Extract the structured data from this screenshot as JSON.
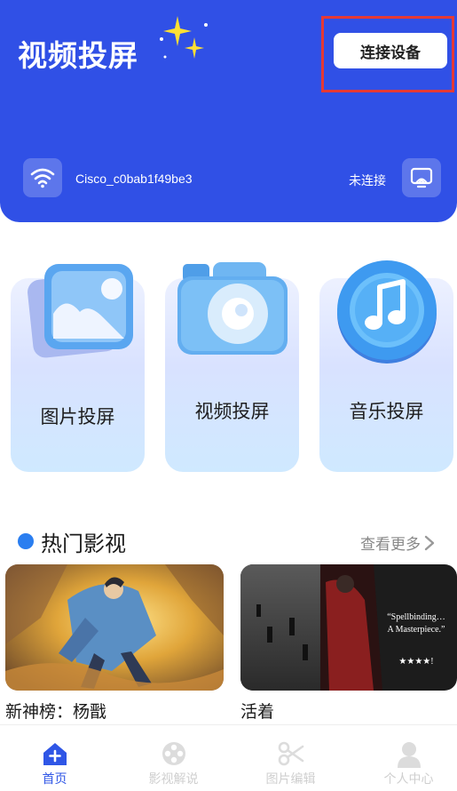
{
  "header": {
    "title": "视频投屏",
    "connect_button": "连接设备",
    "wifi_name": "Cisco_c0bab1f49be3",
    "connection_status": "未连接",
    "wifi_icon": "wifi-icon",
    "cast_icon": "screen-cast-icon"
  },
  "features": [
    {
      "label": "图片投屏",
      "icon": "image-icon"
    },
    {
      "label": "视频投屏",
      "icon": "camera-icon"
    },
    {
      "label": "音乐投屏",
      "icon": "music-note-icon"
    }
  ],
  "section": {
    "title": "热门影视",
    "see_more": "查看更多"
  },
  "movies": [
    {
      "title": "新神榜：杨戬"
    },
    {
      "title": "活着",
      "poster_quote": "“Spellbinding… A Masterpiece.”",
      "poster_stars": "★★★★!"
    }
  ],
  "bottom_nav": [
    {
      "label": "首页",
      "icon": "home-icon",
      "active": true
    },
    {
      "label": "影视解说",
      "icon": "film-reel-icon",
      "active": false
    },
    {
      "label": "图片编辑",
      "icon": "scissors-icon",
      "active": false
    },
    {
      "label": "个人中心",
      "icon": "person-icon",
      "active": false
    }
  ],
  "colors": {
    "primary": "#3050e6",
    "accent_red_outline": "#e53935",
    "section_dot": "#2a7ef0",
    "nav_active": "#2f56e6"
  }
}
